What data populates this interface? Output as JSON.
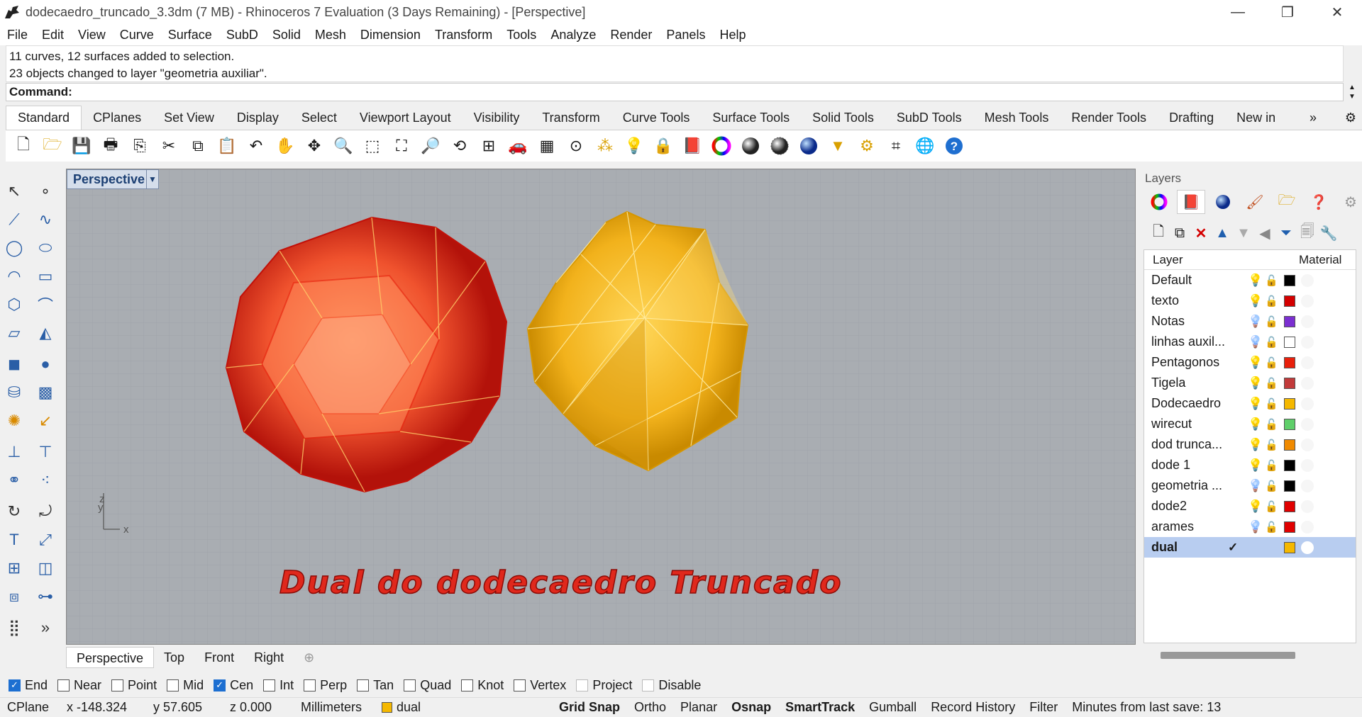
{
  "window": {
    "title": "dodecaedro_truncado_3.3dm (7 MB) - Rhinoceros 7 Evaluation (3 Days Remaining) - [Perspective]",
    "minimize": "—",
    "maximize": "❐",
    "close": "✕"
  },
  "menu": [
    "File",
    "Edit",
    "View",
    "Curve",
    "Surface",
    "SubD",
    "Solid",
    "Mesh",
    "Dimension",
    "Transform",
    "Tools",
    "Analyze",
    "Render",
    "Panels",
    "Help"
  ],
  "command_history": [
    "11 curves, 12 surfaces added to selection.",
    "23 objects changed to layer \"geometria auxiliar\"."
  ],
  "command_prompt": "Command:",
  "toolbar_tabs": [
    "Standard",
    "CPlanes",
    "Set View",
    "Display",
    "Select",
    "Viewport Layout",
    "Visibility",
    "Transform",
    "Curve Tools",
    "Surface Tools",
    "Solid Tools",
    "SubD Tools",
    "Mesh Tools",
    "Render Tools",
    "Drafting",
    "New in"
  ],
  "toolbar_tabs_more": "»",
  "toolbar_icons": [
    "new-file",
    "open-file",
    "save",
    "print",
    "import",
    "cut",
    "copy",
    "paste",
    "undo",
    "pan",
    "rotate-view",
    "zoom",
    "zoom-window",
    "zoom-extents",
    "zoom-selected",
    "rotate-camera",
    "four-viewports",
    "car-model",
    "grid-plane",
    "circle-point",
    "snap-points",
    "lightbulb",
    "lock",
    "layer-book",
    "color-wheel",
    "shaded-sphere",
    "rendered-sphere",
    "blue-sphere",
    "light-cone",
    "gear",
    "sticky-points",
    "globe-render",
    "help"
  ],
  "viewport": {
    "name": "Perspective",
    "annotation": "Dual do dodecaedro Truncado",
    "axis_x": "x",
    "axis_y": "y",
    "axis_z": "z"
  },
  "viewport_tabs": [
    "Perspective",
    "Top",
    "Front",
    "Right"
  ],
  "viewport_tabs_add": "⊕",
  "osnaps": [
    {
      "label": "End",
      "checked": true
    },
    {
      "label": "Near",
      "checked": false
    },
    {
      "label": "Point",
      "checked": false
    },
    {
      "label": "Mid",
      "checked": false
    },
    {
      "label": "Cen",
      "checked": true
    },
    {
      "label": "Int",
      "checked": false
    },
    {
      "label": "Perp",
      "checked": false
    },
    {
      "label": "Tan",
      "checked": false
    },
    {
      "label": "Quad",
      "checked": false
    },
    {
      "label": "Knot",
      "checked": false
    },
    {
      "label": "Vertex",
      "checked": false
    },
    {
      "label": "Project",
      "checked": false
    },
    {
      "label": "Disable",
      "checked": false
    }
  ],
  "status": {
    "cplane": "CPlane",
    "x": "x -148.324",
    "y": "y 57.605",
    "z": "z 0.000",
    "units": "Millimeters",
    "layer": "dual",
    "layer_color": "#f5b800",
    "grid_snap": "Grid Snap",
    "ortho": "Ortho",
    "planar": "Planar",
    "osnap": "Osnap",
    "smarttrack": "SmartTrack",
    "gumball": "Gumball",
    "record_history": "Record History",
    "filter": "Filter",
    "save_info": "Minutes from last save: 13"
  },
  "layers_panel": {
    "title": "Layers",
    "col_layer": "Layer",
    "col_material": "Material",
    "current_check": "✓",
    "rows": [
      {
        "name": "Default",
        "color": "#000000",
        "bulb": "on"
      },
      {
        "name": "texto",
        "color": "#d40000",
        "bulb": "on"
      },
      {
        "name": "Notas",
        "color": "#7b2fd1",
        "bulb": "off"
      },
      {
        "name": "linhas auxil...",
        "color": "#ffffff",
        "bulb": "off"
      },
      {
        "name": "Pentagonos",
        "color": "#e8200c",
        "bulb": "on"
      },
      {
        "name": "Tigela",
        "color": "#c23b3b",
        "bulb": "on"
      },
      {
        "name": "Dodecaedro",
        "color": "#f5b800",
        "bulb": "on"
      },
      {
        "name": "wirecut",
        "color": "#5fcf6a",
        "bulb": "on"
      },
      {
        "name": "dod trunca...",
        "color": "#f08a00",
        "bulb": "on"
      },
      {
        "name": "dode 1",
        "color": "#000000",
        "bulb": "on"
      },
      {
        "name": "geometria ...",
        "color": "#000000",
        "bulb": "off"
      },
      {
        "name": "dode2",
        "color": "#e00000",
        "bulb": "on"
      },
      {
        "name": "arames",
        "color": "#e00000",
        "bulb": "off"
      },
      {
        "name": "dual",
        "color": "#f5b800",
        "bulb": "current"
      }
    ]
  },
  "colors": {
    "viewport_bg": "#a9adb2",
    "red_solid": "#e02a1a",
    "gold_solid": "#f2b21c",
    "selection_blue": "#b8cdf0"
  }
}
